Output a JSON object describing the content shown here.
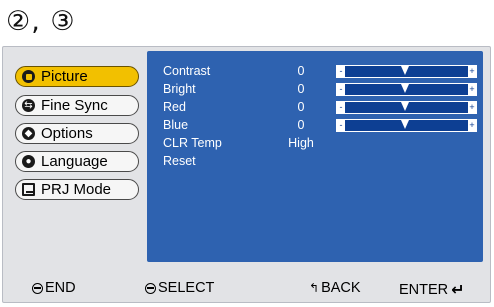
{
  "heading": "②, ③",
  "menu": [
    {
      "label": "Picture",
      "icon": "picture-icon",
      "selected": true
    },
    {
      "label": "Fine Sync",
      "icon": "fine-sync-icon",
      "selected": false
    },
    {
      "label": "Options",
      "icon": "options-icon",
      "selected": false
    },
    {
      "label": "Language",
      "icon": "language-icon",
      "selected": false
    },
    {
      "label": "PRJ Mode",
      "icon": "prj-mode-icon",
      "selected": false
    }
  ],
  "settings": [
    {
      "label": "Contrast",
      "value": "0",
      "slider": 0.49
    },
    {
      "label": "Bright",
      "value": "0",
      "slider": 0.49
    },
    {
      "label": "Red",
      "value": "0",
      "slider": 0.49
    },
    {
      "label": "Blue",
      "value": "0",
      "slider": 0.49
    },
    {
      "label": "CLR Temp",
      "value": "High"
    },
    {
      "label": "Reset",
      "value": ""
    }
  ],
  "slider_minus": "-",
  "slider_plus": "+",
  "footer": {
    "end": "END",
    "select": "SELECT",
    "back": "BACK",
    "enter": "ENTER"
  },
  "colors": {
    "panel": "#2e62b0",
    "frame": "#e2e3e6",
    "selected": "#f2c000"
  }
}
